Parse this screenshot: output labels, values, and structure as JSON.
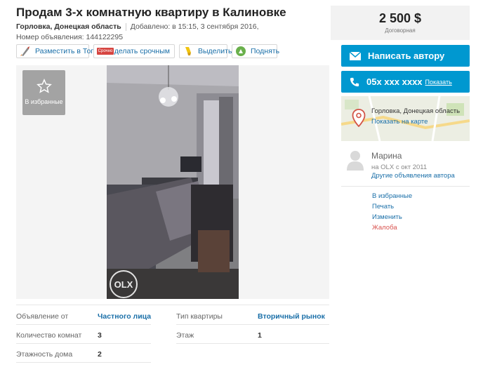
{
  "listing": {
    "title": "Продам 3-х комнатную квартиру в Калиновке",
    "location": "Горловка, Донецкая область",
    "added": "Добавлено: в 15:15, 3 сентября 2016,",
    "ad_number": "Номер объявления: 144122295"
  },
  "toolbar": {
    "promote_top": "Разместить в Топ",
    "make_urgent": "Сделать срочным",
    "urgent_badge": "Срочно",
    "highlight": "Выделить",
    "bump": "Поднять"
  },
  "gallery": {
    "favorite_label": "В избранные",
    "watermark": "OLX"
  },
  "price": {
    "amount": "2 500 $",
    "note": "Договорная"
  },
  "contact": {
    "write_author": "Написать автору",
    "phone_masked": "05x xxx xxxx",
    "show_phone": "Показать"
  },
  "map": {
    "location": "Горловка, Донецкая область",
    "show_on_map": "Показать на карте"
  },
  "seller": {
    "name": "Марина",
    "since": "на OLX с окт 2011",
    "other_ads": "Другие объявления автора"
  },
  "actions": [
    "В избранные",
    "Печать",
    "Изменить",
    "Жалоба"
  ],
  "details": [
    [
      {
        "label": "Объявление от",
        "value": "Частного лица",
        "link": true
      },
      {
        "label": "Тип квартиры",
        "value": "Вторичный рынок",
        "link": true
      }
    ],
    [
      {
        "label": "Количество комнат",
        "value": "3",
        "link": false
      },
      {
        "label": "Этаж",
        "value": "1",
        "link": false
      }
    ],
    [
      {
        "label": "Этажность дома",
        "value": "2",
        "link": false
      }
    ]
  ],
  "colors": {
    "accent": "#0098d0",
    "link": "#1a6fa8",
    "report": "#d9534f"
  }
}
